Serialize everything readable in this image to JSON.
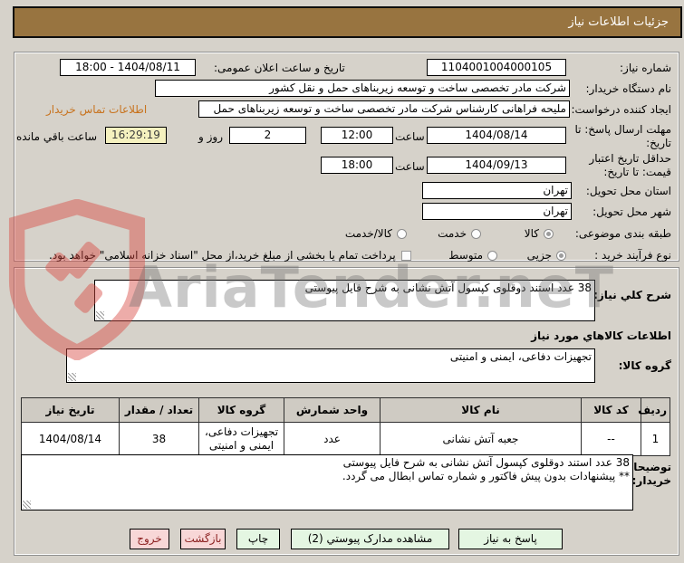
{
  "title_bar": {
    "title": "جزئیات اطلاعات نیاز"
  },
  "form": {
    "need_number": {
      "label": "شماره نیاز:",
      "value": "1104001004000105"
    },
    "announce_datetime": {
      "label": "تاریخ و ساعت اعلان عمومی:",
      "value": "1404/08/11 - 18:00"
    },
    "buyer_org": {
      "label": "نام دستگاه خریدار:",
      "value": "شرکت مادر تخصصی ساخت و توسعه زیربناهای حمل و نقل کشور"
    },
    "request_creator": {
      "label": "ایجاد کننده درخواست:",
      "value": "ملیحه فراهانی کارشناس شرکت مادر تخصصی ساخت و توسعه زیربناهای حمل",
      "contact_link": "اطلاعات تماس خریدار"
    },
    "response_deadline": {
      "label": "مهلت ارسال پاسخ: تا تاریخ:",
      "date": "1404/08/14",
      "hour_label": "ساعت",
      "time": "12:00",
      "days": "2",
      "days_label": "روز و",
      "countdown": "16:29:19",
      "remaining_label": "ساعت باقي مانده"
    },
    "price_validity": {
      "label": "حداقل تاریخ اعتبار قیمت: تا تاریخ:",
      "date": "1404/09/13",
      "hour_label": "ساعت",
      "time": "18:00"
    },
    "province": {
      "label": "استان محل تحویل:",
      "value": "تهران"
    },
    "city": {
      "label": "شهر محل تحویل:",
      "value": "تهران"
    },
    "subject_class": {
      "label": "طبقه بندی موضوعی:",
      "options": [
        {
          "label": "کالا",
          "selected": true
        },
        {
          "label": "خدمت",
          "selected": false
        },
        {
          "label": "کالا/خدمت",
          "selected": false
        }
      ]
    },
    "purchase_type": {
      "label": "نوع فرآیند خرید :",
      "options": [
        {
          "label": "جزیی",
          "selected": true
        },
        {
          "label": "متوسط",
          "selected": false
        }
      ],
      "treasury_checkbox": {
        "label": "پرداخت تمام یا بخشی از مبلغ خرید،از محل \"اسناد خزانه اسلامی\" خواهد بود.",
        "checked": false
      }
    }
  },
  "need_desc": {
    "label": "شرح کلي نیاز:",
    "value": "38 عدد استند دوقلوی کپسول آتش نشانی به شرح فایل پیوستی"
  },
  "goods_section": {
    "heading": "اطلاعات کالاهاي مورد نیاز",
    "group_label": "گروه کالا:",
    "group_value": "تجهیزات دفاعی، ایمنی و امنیتی"
  },
  "goods_table": {
    "headers": [
      "ردیف",
      "کد کالا",
      "نام کالا",
      "واحد شمارش",
      "گروه کالا",
      "تعداد / مقدار",
      "تاریخ نیاز"
    ],
    "rows": [
      [
        "1",
        "--",
        "جعبه آتش نشانی",
        "عدد",
        "تجهیزات دفاعی، ایمنی و امنیتی",
        "38",
        "1404/08/14"
      ]
    ]
  },
  "buyer_notes": {
    "label": "توضیحات خریدار:",
    "lines": [
      "38 عدد استند دوقلوی کپسول آتش نشانی به شرح فایل پیوستی",
      "** پیشنهادات بدون پیش فاکتور و شماره تماس ابطال می گردد."
    ]
  },
  "buttons": {
    "respond": "پاسخ به نیاز",
    "view_docs": "مشاهده مدارک پیوستي (2)",
    "print": "چاپ",
    "back": "بازگشت",
    "exit": "خروج"
  },
  "watermark": {
    "text": "AriaTender.neT"
  },
  "colors": {
    "titlebar": "#987440",
    "link_orange": "#c8731e",
    "countdown_bg": "#f5f1bf",
    "button_green": "#e4f6e2",
    "button_pink": "#f8d7d7",
    "watermark_red": "#d94a42"
  }
}
